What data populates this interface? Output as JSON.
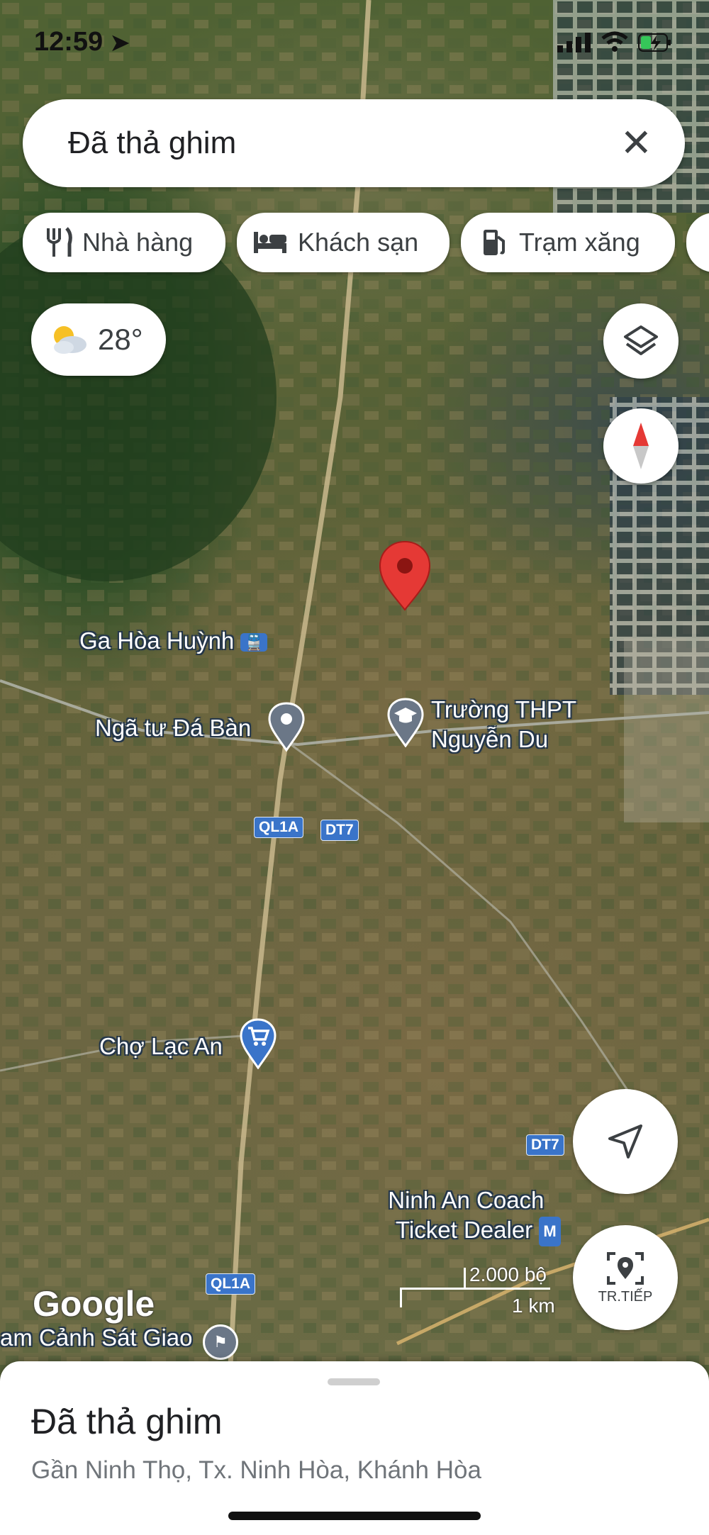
{
  "status": {
    "time": "12:59"
  },
  "search": {
    "text": "Đã thả ghim"
  },
  "chips": [
    {
      "icon": "restaurant-icon",
      "label": "Nhà hàng"
    },
    {
      "icon": "hotel-icon",
      "label": "Khách sạn"
    },
    {
      "icon": "gas-station-icon",
      "label": "Trạm xăng"
    }
  ],
  "weather": {
    "temp": "28°"
  },
  "places": {
    "station": "Ga Hòa Huỳnh",
    "intersection": "Ngã tư Đá Bàn",
    "school_line1": "Trường THPT",
    "school_line2": "Nguyễn Du",
    "market": "Chợ Lạc An",
    "coach_line1": "Ninh An Coach",
    "coach_line2": "Ticket Dealer",
    "coach_badge": "M",
    "police": "am Cảnh Sát Giao"
  },
  "roads": {
    "ql1a": "QL1A",
    "dt7": "DT7"
  },
  "scale": {
    "top": "2.000 bộ",
    "bottom": "1 km"
  },
  "google_logo": "Google",
  "live_view_label": "TR.TIẾP",
  "sheet": {
    "title": "Đã thả ghim",
    "subtitle": "Gần Ninh Thọ, Tx. Ninh Hòa, Khánh Hòa"
  },
  "colors": {
    "pin": "#e53935",
    "road_shield": "#3a74c9",
    "accent": "#1a73e8"
  }
}
